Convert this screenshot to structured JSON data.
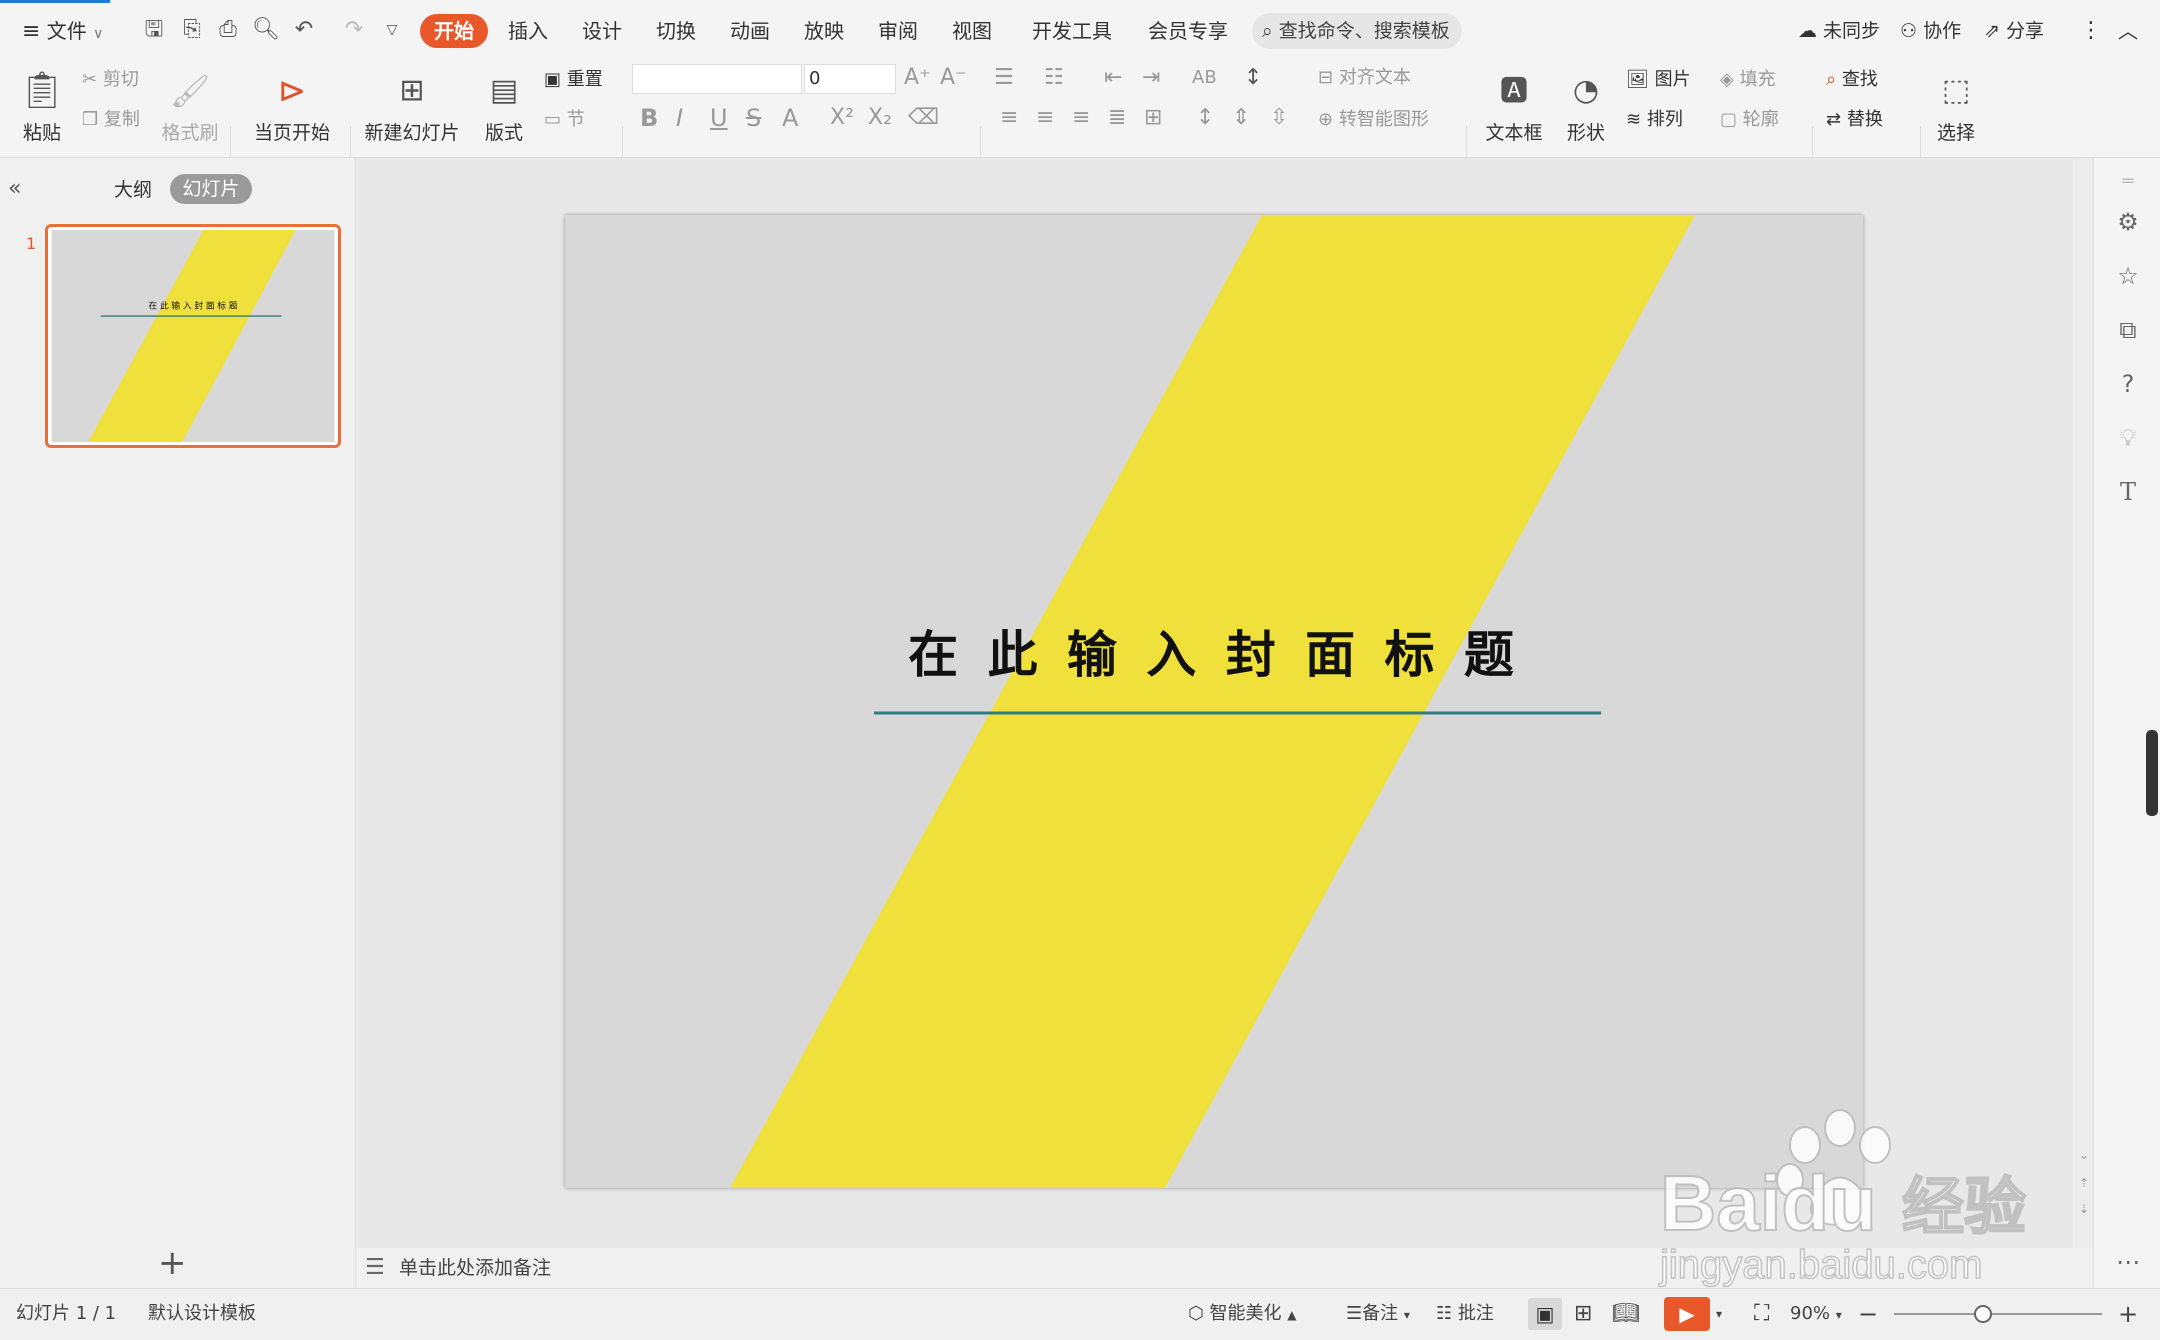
{
  "menubar": {
    "file_label": "文件",
    "tabs": [
      "开始",
      "插入",
      "设计",
      "切换",
      "动画",
      "放映",
      "审阅",
      "视图",
      "开发工具",
      "会员专享"
    ],
    "search_placeholder": "查找命令、搜索模板",
    "sync_label": "未同步",
    "collab_label": "协作",
    "share_label": "分享"
  },
  "ribbon": {
    "paste": "粘贴",
    "cut": "剪切",
    "copy": "复制",
    "format_painter": "格式刷",
    "play_from_current": "当页开始",
    "new_slide": "新建幻灯片",
    "layout": "版式",
    "reset": "重置",
    "section": "节",
    "font_size": "0",
    "align_text": "对齐文本",
    "smartart": "转智能图形",
    "textbox": "文本框",
    "shape": "形状",
    "picture": "图片",
    "fill": "填充",
    "arrange": "排列",
    "outline": "轮廓",
    "find": "查找",
    "replace": "替换",
    "select": "选择"
  },
  "leftpane": {
    "tab_outline": "大纲",
    "tab_slides": "幻灯片",
    "slide_number": "1",
    "thumb_title": "在 此 输 入 封 面 标 题"
  },
  "slide": {
    "title": "在 此 输 入 封 面 标 题",
    "band_color": "#f0e03c",
    "background_color": "#d8d8d8",
    "underline_color": "#2e7d7a"
  },
  "notes": {
    "placeholder": "单击此处添加备注"
  },
  "statusbar": {
    "slide_count": "幻灯片 1 / 1",
    "template": "默认设计模板",
    "beautify": "智能美化",
    "notes": "备注",
    "comments": "批注",
    "zoom": "90%"
  },
  "watermark": {
    "brand": "Baidu",
    "cn": "经验",
    "url": "jingyan.baidu.com"
  }
}
